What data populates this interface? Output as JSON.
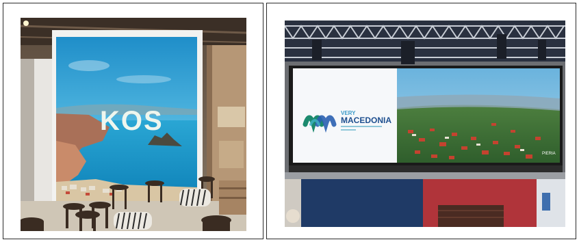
{
  "photos": [
    {
      "kind": "trade-show-booth-kos",
      "screen_text": "KOS"
    },
    {
      "kind": "trade-show-screen-macedonia",
      "screen_text_top": "VERY",
      "screen_text_main": "MACEDONIA",
      "screen_logo": "MM",
      "screen_corner_text": "PIERIA"
    }
  ]
}
